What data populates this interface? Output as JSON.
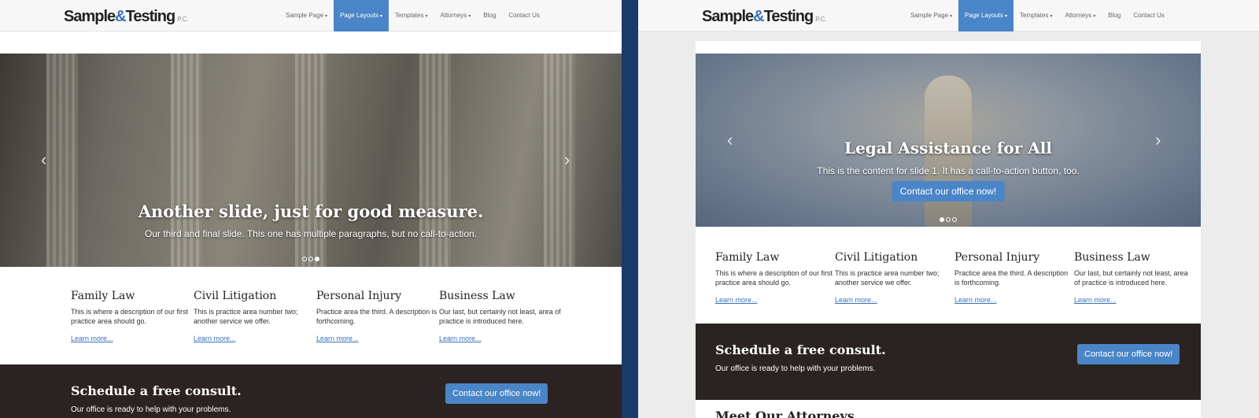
{
  "brand": {
    "name_part1": "Sample",
    "amp": "&",
    "name_part2": "Testing",
    "suffix": "P.C."
  },
  "nav": [
    {
      "label": "Sample Page",
      "dropdown": true
    },
    {
      "label": "Page Layouts",
      "dropdown": true
    },
    {
      "label": "Templates",
      "dropdown": true
    },
    {
      "label": "Attorneys",
      "dropdown": true
    },
    {
      "label": "Blog",
      "dropdown": false
    },
    {
      "label": "Contact Us",
      "dropdown": false
    }
  ],
  "left": {
    "slide_title": "Another slide, just for good measure.",
    "slide_text": "Our third and final slide. This one has multiple paragraphs, but no call-to-action."
  },
  "right": {
    "slide_title": "Legal Assistance for All",
    "slide_text": "This is the content for slide 1. It has a call-to-action button, too.",
    "slide_cta": "Contact our office now!",
    "section_title": "Meet Our Attorneys"
  },
  "practice_areas": {
    "left": [
      {
        "title": "Family Law",
        "desc": "This is where a description of our first practice area should go.",
        "link": "Learn more..."
      },
      {
        "title": "Civil Litigation",
        "desc": "This is practice area number two; another service we offer.",
        "link": "Learn more..."
      },
      {
        "title": "Personal Injury",
        "desc": "Practice area the third. A description is forthcoming.",
        "link": "Learn more..."
      },
      {
        "title": "Business Law",
        "desc": "Our last, but certainly not least, area of practice is introduced here.",
        "link": "Learn more..."
      }
    ],
    "right": [
      {
        "title": "Family Law",
        "desc": "This is where a description of our first practice area should go.",
        "link": "Learn more..."
      },
      {
        "title": "Civil Litigation",
        "desc": "This is practice area number two; another service we offer.",
        "link": "Learn more..."
      },
      {
        "title": "Personal Injury",
        "desc": "Practice area the third. A description is forthcoming.",
        "link": "Learn more..."
      },
      {
        "title": "Business Law",
        "desc": "Our last, but certainly not least, area of practice is introduced here.",
        "link": "Learn more..."
      }
    ]
  },
  "cta": {
    "title": "Schedule a free consult.",
    "text": "Our office is ready to help with your problems.",
    "button": "Contact our office now!"
  },
  "colors": {
    "accent": "#4a85c7",
    "dark_band": "#2a2321",
    "divider": "#1a3a6b"
  },
  "icons": {
    "prev": "chevron-left-icon",
    "next": "chevron-right-icon",
    "caret": "caret-down-icon"
  }
}
